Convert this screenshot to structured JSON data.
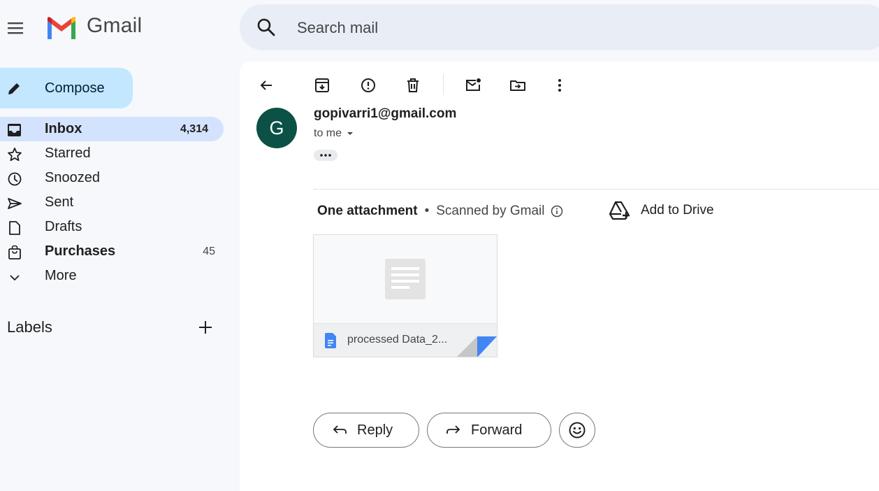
{
  "app": {
    "brand": "Gmail",
    "brand_colors": {
      "red": "#ea4335",
      "blue": "#4285f4",
      "green": "#34a853",
      "yellow": "#fbbc04"
    }
  },
  "search": {
    "placeholder": "Search mail",
    "icon": "search-icon"
  },
  "sidebar": {
    "compose_label": "Compose",
    "items": [
      {
        "label": "Inbox",
        "count": "4,314",
        "icon": "inbox-icon",
        "active": true
      },
      {
        "label": "Starred",
        "count": "",
        "icon": "star-icon"
      },
      {
        "label": "Snoozed",
        "count": "",
        "icon": "clock-icon"
      },
      {
        "label": "Sent",
        "count": "",
        "icon": "send-icon"
      },
      {
        "label": "Drafts",
        "count": "",
        "icon": "draft-icon"
      },
      {
        "label": "Purchases",
        "count": "45",
        "icon": "shopping-bag-icon"
      },
      {
        "label": "More",
        "count": "",
        "icon": "chevron-down-icon"
      }
    ],
    "labels_title": "Labels"
  },
  "toolbar": {
    "icons": [
      "back-arrow-icon",
      "archive-icon",
      "report-spam-icon",
      "delete-icon",
      "mark-unread-icon",
      "move-to-icon",
      "more-vert-icon"
    ]
  },
  "message": {
    "avatar_letter": "G",
    "avatar_color": "#0b5145",
    "sender": "gopivarri1@gmail.com",
    "recipient": "to me",
    "attachments": {
      "title": "One attachment",
      "separator": "•",
      "scanned": "Scanned by Gmail",
      "add_to_drive": "Add to Drive",
      "files": [
        {
          "name": "processed Data_2..."
        }
      ]
    },
    "actions": {
      "reply": "Reply",
      "forward": "Forward"
    }
  }
}
